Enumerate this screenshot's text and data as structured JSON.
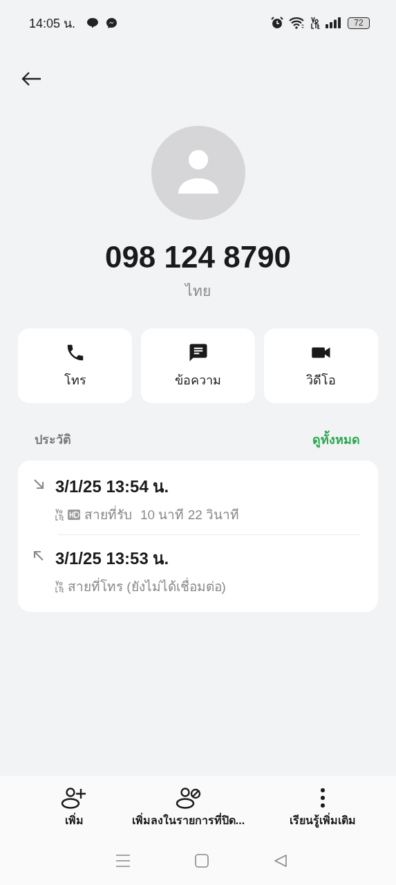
{
  "status_bar": {
    "time": "14:05 น.",
    "battery": "72"
  },
  "contact": {
    "number": "098 124 8790",
    "region": "ไทย"
  },
  "actions": [
    {
      "kind": "call",
      "label": "โทร"
    },
    {
      "kind": "message",
      "label": "ข้อความ"
    },
    {
      "kind": "video",
      "label": "วิดีโอ"
    }
  ],
  "history": {
    "title": "ประวัติ",
    "see_all": "ดูทั้งหมด",
    "calls": [
      {
        "kind": "incoming",
        "time": "3/1/25 13:54 น.",
        "hd": true,
        "type": "สายที่รับ",
        "duration": "10 นาที 22 วินาที"
      },
      {
        "kind": "outgoing",
        "time": "3/1/25 13:53 น.",
        "hd": false,
        "type": "สายที่โทร (ยังไม่ได้เชื่อมต่อ)"
      }
    ]
  },
  "bottom_actions": [
    {
      "kind": "add",
      "label": "เพิ่ม"
    },
    {
      "kind": "block",
      "label": "เพิ่มลงในรายการที่ปิด..."
    },
    {
      "kind": "more",
      "label": "เรียนรู้เพิ่มเติม"
    }
  ]
}
